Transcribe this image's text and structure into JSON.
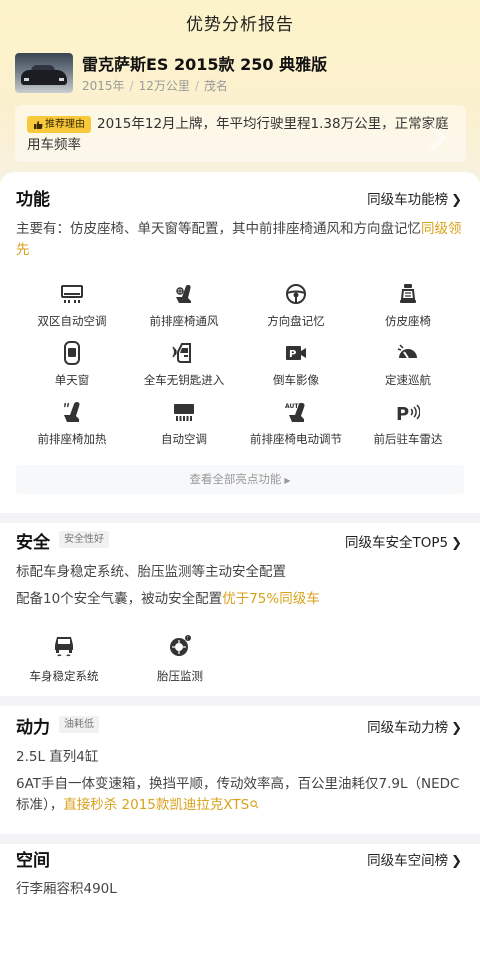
{
  "page_title": "优势分析报告",
  "car": {
    "name": "雷克萨斯ES 2015款 250 典雅版",
    "year": "2015年",
    "mileage": "12万公里",
    "city": "茂名"
  },
  "recommend": {
    "tag": "推荐理由",
    "text": "2015年12月上牌，年平均行驶里程1.38万公里，正常家庭用车频率"
  },
  "function": {
    "title": "功能",
    "link": "同级车功能榜",
    "desc_prefix": "主要有：仿皮座椅、单天窗等配置，其中前排座椅通风和方向盘记忆",
    "desc_highlight": "同级领先",
    "items": [
      {
        "label": "双区自动空调",
        "icon": "dual-zone-ac-icon"
      },
      {
        "label": "前排座椅通风",
        "icon": "seat-ventilation-icon"
      },
      {
        "label": "方向盘记忆",
        "icon": "steering-wheel-memory-icon"
      },
      {
        "label": "仿皮座椅",
        "icon": "leather-seat-icon"
      },
      {
        "label": "单天窗",
        "icon": "sunroof-icon"
      },
      {
        "label": "全车无钥匙进入",
        "icon": "keyless-entry-icon"
      },
      {
        "label": "倒车影像",
        "icon": "reverse-camera-icon"
      },
      {
        "label": "定速巡航",
        "icon": "cruise-control-icon"
      },
      {
        "label": "前排座椅加热",
        "icon": "seat-heating-icon"
      },
      {
        "label": "自动空调",
        "icon": "auto-ac-icon"
      },
      {
        "label": "前排座椅电动调节",
        "icon": "power-seat-icon"
      },
      {
        "label": "前后驻车雷达",
        "icon": "parking-radar-icon"
      }
    ],
    "view_all": "查看全部亮点功能"
  },
  "safety": {
    "title": "安全",
    "badge": "安全性好",
    "link": "同级车安全TOP5",
    "line1": "标配车身稳定系统、胎压监测等主动安全配置",
    "line2_prefix": "配备10个安全气囊，被动安全配置",
    "line2_highlight": "优于75%同级车",
    "items": [
      {
        "label": "车身稳定系统",
        "icon": "stability-control-icon"
      },
      {
        "label": "胎压监测",
        "icon": "tire-pressure-icon"
      }
    ]
  },
  "power": {
    "title": "动力",
    "badge": "油耗低",
    "link": "同级车动力榜",
    "engine": "2.5L 直列4缸",
    "desc": "6AT手自一体变速箱，换挡平顺，传动效率高，百公里油耗仅7.9L（NEDC标准），",
    "compare": "直接秒杀 2015款凯迪拉克XTS"
  },
  "space": {
    "title": "空间",
    "link": "同级车空间榜",
    "trunk": "行李厢容积490L"
  },
  "colors": {
    "accent": "#d9a21a",
    "tag_bg": "#f8c93a",
    "hero_bg": "#fdf3c8"
  }
}
